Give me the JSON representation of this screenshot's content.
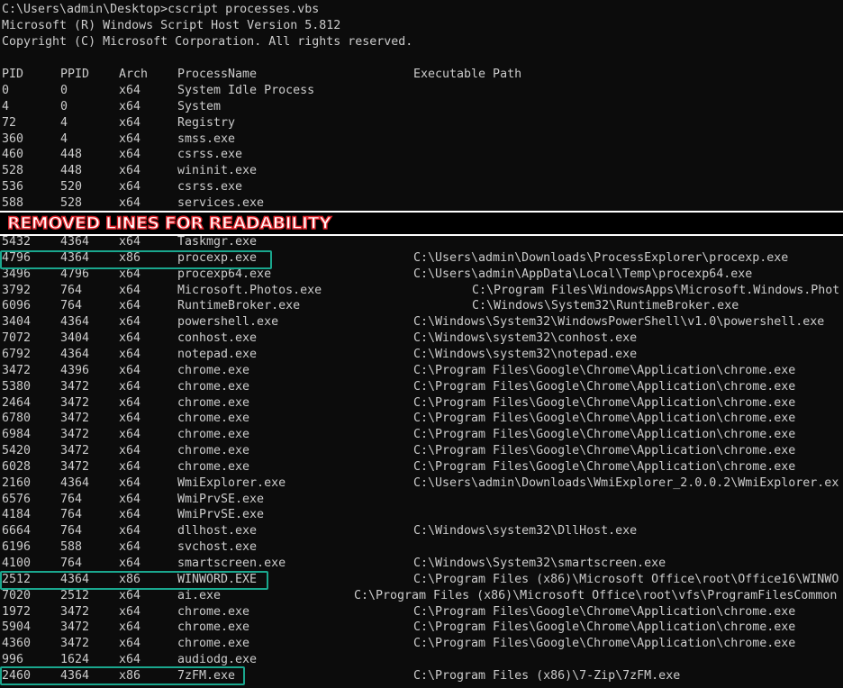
{
  "header": {
    "prompt": "C:\\Users\\admin\\Desktop>cscript processes.vbs",
    "version": "Microsoft (R) Windows Script Host Version 5.812",
    "copyright": "Copyright (C) Microsoft Corporation. All rights reserved."
  },
  "columns": {
    "pid": "PID",
    "ppid": "PPID",
    "arch": "Arch",
    "name": "ProcessName",
    "path": "Executable Path"
  },
  "banner": "REMOVED LINES FOR READABILITY",
  "rows_top": [
    {
      "pid": "0",
      "ppid": "0",
      "arch": "x64",
      "name": "System Idle Process",
      "path": ""
    },
    {
      "pid": "4",
      "ppid": "0",
      "arch": "x64",
      "name": "System",
      "path": ""
    },
    {
      "pid": "72",
      "ppid": "4",
      "arch": "x64",
      "name": "Registry",
      "path": ""
    },
    {
      "pid": "360",
      "ppid": "4",
      "arch": "x64",
      "name": "smss.exe",
      "path": ""
    },
    {
      "pid": "460",
      "ppid": "448",
      "arch": "x64",
      "name": "csrss.exe",
      "path": ""
    },
    {
      "pid": "528",
      "ppid": "448",
      "arch": "x64",
      "name": "wininit.exe",
      "path": ""
    },
    {
      "pid": "536",
      "ppid": "520",
      "arch": "x64",
      "name": "csrss.exe",
      "path": ""
    },
    {
      "pid": "588",
      "ppid": "528",
      "arch": "x64",
      "name": "services.exe",
      "path": ""
    }
  ],
  "rows_bottom": [
    {
      "pid": "5432",
      "ppid": "4364",
      "arch": "x64",
      "name": "Taskmgr.exe",
      "path": ""
    },
    {
      "pid": "4796",
      "ppid": "4364",
      "arch": "x86",
      "name": "procexp.exe",
      "path": "C:\\Users\\admin\\Downloads\\ProcessExplorer\\procexp.exe"
    },
    {
      "pid": "3496",
      "ppid": "4796",
      "arch": "x64",
      "name": "procexp64.exe",
      "path": "C:\\Users\\admin\\AppData\\Local\\Temp\\procexp64.exe"
    },
    {
      "pid": "3792",
      "ppid": "764",
      "arch": "x64",
      "name": "Microsoft.Photos.exe",
      "path": "C:\\Program Files\\WindowsApps\\Microsoft.Windows.Phot"
    },
    {
      "pid": "6096",
      "ppid": "764",
      "arch": "x64",
      "name": "RuntimeBroker.exe",
      "path": "C:\\Windows\\System32\\RuntimeBroker.exe"
    },
    {
      "pid": "3404",
      "ppid": "4364",
      "arch": "x64",
      "name": "powershell.exe",
      "path": "C:\\Windows\\System32\\WindowsPowerShell\\v1.0\\powershell.exe"
    },
    {
      "pid": "7072",
      "ppid": "3404",
      "arch": "x64",
      "name": "conhost.exe",
      "path": "C:\\Windows\\system32\\conhost.exe"
    },
    {
      "pid": "6792",
      "ppid": "4364",
      "arch": "x64",
      "name": "notepad.exe",
      "path": "C:\\Windows\\system32\\notepad.exe"
    },
    {
      "pid": "3472",
      "ppid": "4396",
      "arch": "x64",
      "name": "chrome.exe",
      "path": "C:\\Program Files\\Google\\Chrome\\Application\\chrome.exe"
    },
    {
      "pid": "5380",
      "ppid": "3472",
      "arch": "x64",
      "name": "chrome.exe",
      "path": "C:\\Program Files\\Google\\Chrome\\Application\\chrome.exe"
    },
    {
      "pid": "2464",
      "ppid": "3472",
      "arch": "x64",
      "name": "chrome.exe",
      "path": "C:\\Program Files\\Google\\Chrome\\Application\\chrome.exe"
    },
    {
      "pid": "6780",
      "ppid": "3472",
      "arch": "x64",
      "name": "chrome.exe",
      "path": "C:\\Program Files\\Google\\Chrome\\Application\\chrome.exe"
    },
    {
      "pid": "6984",
      "ppid": "3472",
      "arch": "x64",
      "name": "chrome.exe",
      "path": "C:\\Program Files\\Google\\Chrome\\Application\\chrome.exe"
    },
    {
      "pid": "5420",
      "ppid": "3472",
      "arch": "x64",
      "name": "chrome.exe",
      "path": "C:\\Program Files\\Google\\Chrome\\Application\\chrome.exe"
    },
    {
      "pid": "6028",
      "ppid": "3472",
      "arch": "x64",
      "name": "chrome.exe",
      "path": "C:\\Program Files\\Google\\Chrome\\Application\\chrome.exe"
    },
    {
      "pid": "2160",
      "ppid": "4364",
      "arch": "x64",
      "name": "WmiExplorer.exe",
      "path": "C:\\Users\\admin\\Downloads\\WmiExplorer_2.0.0.2\\WmiExplorer.ex"
    },
    {
      "pid": "6576",
      "ppid": "764",
      "arch": "x64",
      "name": "WmiPrvSE.exe",
      "path": ""
    },
    {
      "pid": "4184",
      "ppid": "764",
      "arch": "x64",
      "name": "WmiPrvSE.exe",
      "path": ""
    },
    {
      "pid": "6664",
      "ppid": "764",
      "arch": "x64",
      "name": "dllhost.exe",
      "path": "C:\\Windows\\system32\\DllHost.exe"
    },
    {
      "pid": "6196",
      "ppid": "588",
      "arch": "x64",
      "name": "svchost.exe",
      "path": ""
    },
    {
      "pid": "4100",
      "ppid": "764",
      "arch": "x64",
      "name": "smartscreen.exe",
      "path": "C:\\Windows\\System32\\smartscreen.exe"
    },
    {
      "pid": "2512",
      "ppid": "4364",
      "arch": "x86",
      "name": "WINWORD.EXE",
      "path": "C:\\Program Files (x86)\\Microsoft Office\\root\\Office16\\WINWO"
    },
    {
      "pid": "7020",
      "ppid": "2512",
      "arch": "x64",
      "name": "ai.exe",
      "path": "C:\\Program Files (x86)\\Microsoft Office\\root\\vfs\\ProgramFilesCommon"
    },
    {
      "pid": "1972",
      "ppid": "3472",
      "arch": "x64",
      "name": "chrome.exe",
      "path": "C:\\Program Files\\Google\\Chrome\\Application\\chrome.exe"
    },
    {
      "pid": "5904",
      "ppid": "3472",
      "arch": "x64",
      "name": "chrome.exe",
      "path": "C:\\Program Files\\Google\\Chrome\\Application\\chrome.exe"
    },
    {
      "pid": "4360",
      "ppid": "3472",
      "arch": "x64",
      "name": "chrome.exe",
      "path": "C:\\Program Files\\Google\\Chrome\\Application\\chrome.exe"
    },
    {
      "pid": "996",
      "ppid": "1624",
      "arch": "x64",
      "name": "audiodg.exe",
      "path": ""
    },
    {
      "pid": "2460",
      "ppid": "4364",
      "arch": "x86",
      "name": "7zFM.exe",
      "path": "C:\\Program Files (x86)\\7-Zip\\7zFM.exe"
    }
  ]
}
